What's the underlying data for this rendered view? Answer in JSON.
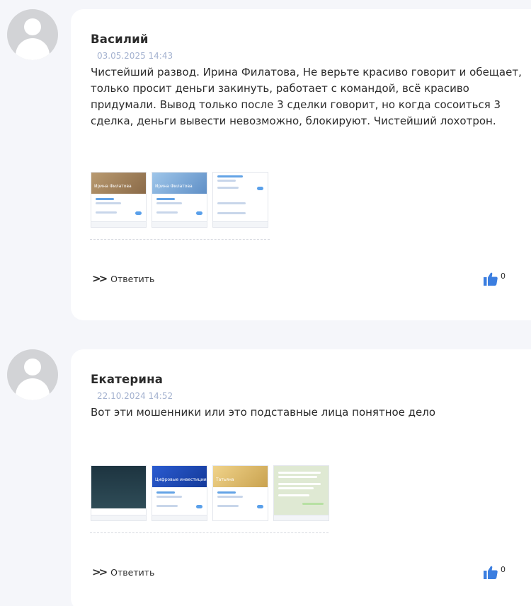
{
  "comments": [
    {
      "author": "Василий",
      "date": "03.05.2025 14:43",
      "text": "Чистейший развод. Ирина Филатова, Не верьте красиво говорит и обещает, только просит деньги закинуть, работает с командой, всё красиво придумали. Вывод только после 3 сделки говорит, но когда сосоиться 3 сделка, деньги вывести невозможно, блокируют. Чистейший лохотрон.",
      "attachments": [
        {
          "caption": "Ирина Филатова"
        },
        {
          "caption": "Ирина Филатова"
        },
        {
          "caption": ""
        }
      ],
      "reply_label": "Ответить",
      "likes": "0"
    },
    {
      "author": "Екатерина",
      "date": "22.10.2024 14:52",
      "text": "Вот эти мошенники или это подставные лица понятное дело",
      "attachments": [
        {
          "caption": ""
        },
        {
          "caption": "Цифровые инвестиции"
        },
        {
          "caption": "Татьяна"
        },
        {
          "caption": ""
        }
      ],
      "reply_label": "Ответить",
      "likes": "0"
    }
  ],
  "icons": {
    "reply": "double-chevron-right-icon",
    "like": "thumbs-up-icon",
    "avatar": "user-avatar-icon"
  },
  "colors": {
    "date": "#a3b1cf",
    "like": "#3b7ee0",
    "card": "#ffffff",
    "page": "#f5f6fa"
  }
}
